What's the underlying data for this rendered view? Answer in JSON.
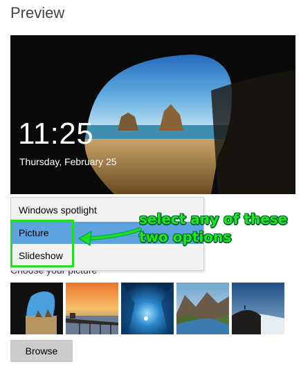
{
  "heading": "Preview",
  "lockscreen": {
    "time": "11:25",
    "date": "Thursday, February 25"
  },
  "dropdown": {
    "options": [
      {
        "label": "Windows spotlight"
      },
      {
        "label": "Picture"
      },
      {
        "label": "Slideshow"
      }
    ],
    "selected": "Picture"
  },
  "annotation": "select any of these\ntwo options",
  "choose_label": "Choose your picture",
  "thumbnails": [
    {
      "name": "sea-cave"
    },
    {
      "name": "sunset-pier"
    },
    {
      "name": "ice-cave"
    },
    {
      "name": "mountain-lake"
    },
    {
      "name": "hill-above-clouds"
    }
  ],
  "browse_label": "Browse",
  "colors": {
    "selected_bg": "#5da3e0",
    "annotation_green": "#22dd22",
    "button_bg": "#cccccc"
  }
}
